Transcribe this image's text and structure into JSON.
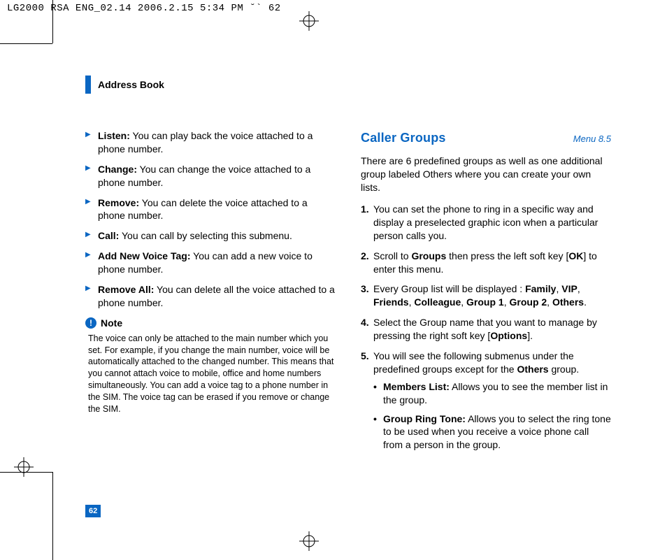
{
  "print_header": "LG2000 RSA ENG_02.14  2006.2.15 5:34 PM  ˘` 62",
  "section_title": "Address Book",
  "page_number": "62",
  "left": {
    "items": [
      {
        "term": "Listen:",
        "desc": " You can play back the voice attached to a phone number."
      },
      {
        "term": "Change:",
        "desc": " You can change the voice attached to a phone number."
      },
      {
        "term": "Remove:",
        "desc": " You can delete the voice attached to a phone number."
      },
      {
        "term": "Call:",
        "desc": " You can call by selecting this submenu."
      },
      {
        "term": "Add New Voice Tag:",
        "desc": " You can add a new voice to phone number."
      },
      {
        "term": "Remove All:",
        "desc": " You can delete all the voice attached to a phone number."
      }
    ],
    "note_label": "Note",
    "note_body": "The voice can only be attached to the main number which you set. For example, if you change the main number, voice will be automatically attached to the changed number. This means that you cannot attach voice to mobile, office and home numbers simultaneously. You can add a voice tag to a phone number in the SIM. The voice tag can be erased if you remove or change the SIM."
  },
  "right": {
    "title": "Caller Groups",
    "menu": "Menu 8.5",
    "intro": "There are 6 predefined groups as well as one additional group labeled Others where you can create your own lists.",
    "steps": {
      "s1": "You can set the phone to ring in a specific way and display a preselected graphic icon when a particular person calls you.",
      "s2_a": "Scroll to ",
      "s2_b": "Groups",
      "s2_c": " then press the left soft key [",
      "s2_d": "OK",
      "s2_e": "] to enter this menu.",
      "s3_a": "Every Group list will be displayed : ",
      "s3_b": "Family",
      "s3_c": ", ",
      "s3_d": "VIP",
      "s3_e": ", ",
      "s3_f": "Friends",
      "s3_g": ", ",
      "s3_h": "Colleague",
      "s3_i": ", ",
      "s3_j": "Group 1",
      "s3_k": ", ",
      "s3_l": "Group 2",
      "s3_m": ", ",
      "s3_n": "Others",
      "s3_o": ".",
      "s4_a": "Select the Group name that you want to manage by pressing the right soft key [",
      "s4_b": "Options",
      "s4_c": "].",
      "s5_a": "You will see the following submenus under the predefined groups except for the ",
      "s5_b": "Others",
      "s5_c": " group.",
      "b1_t": "Members List:",
      "b1_d": " Allows you to see the member list in the group.",
      "b2_t": "Group Ring Tone:",
      "b2_d": " Allows you to select the ring tone to be used when you receive a voice phone call from a person in the group."
    }
  }
}
